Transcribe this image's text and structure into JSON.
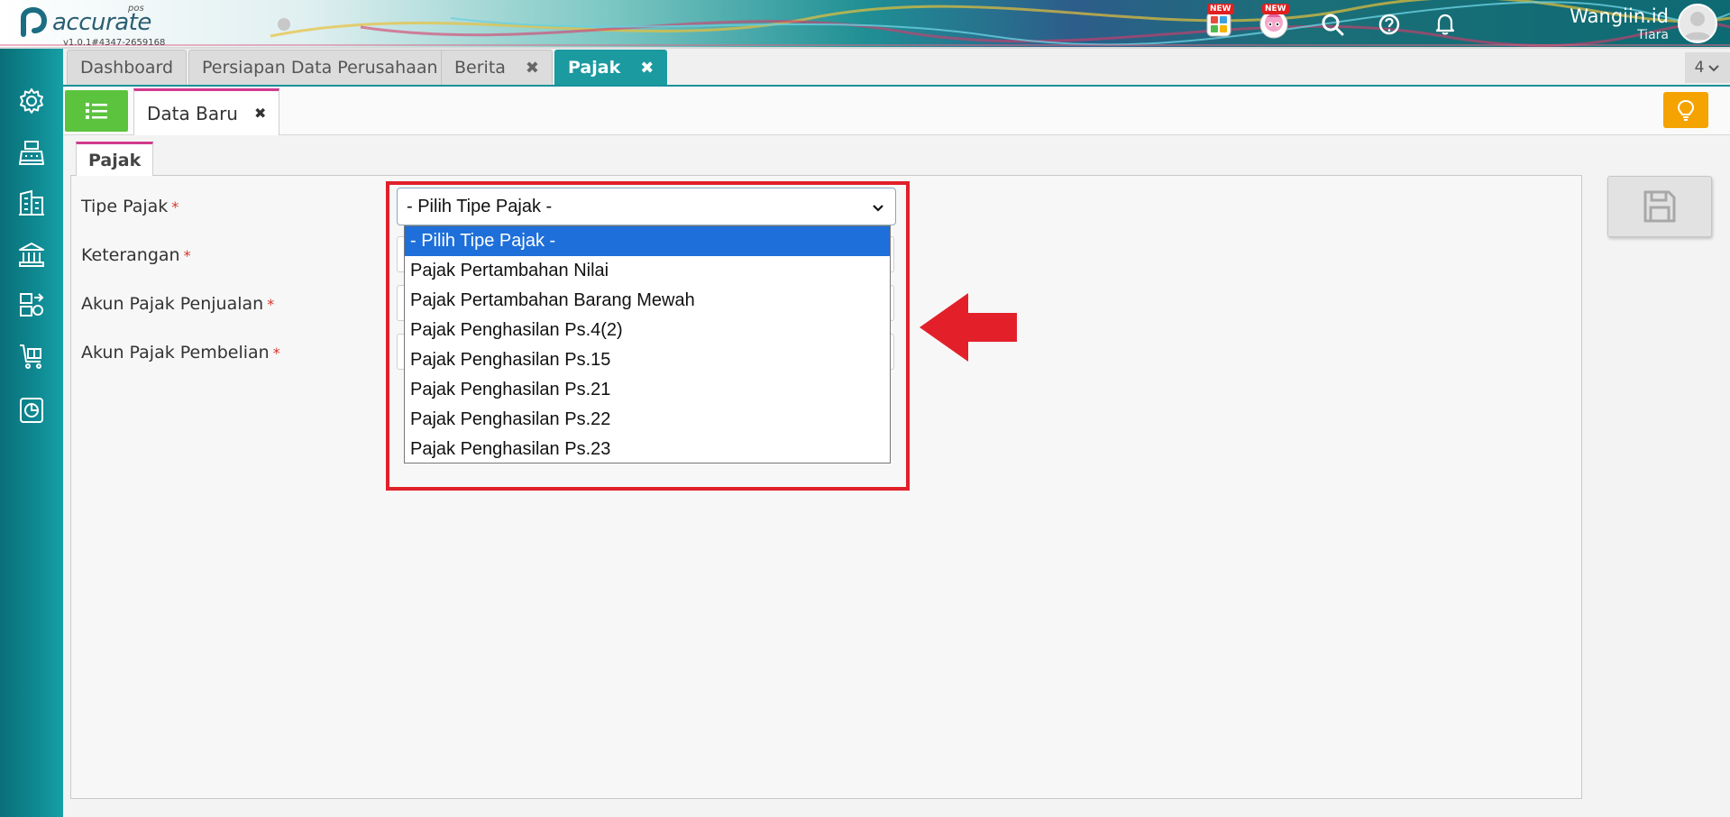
{
  "app": {
    "logo_text": "accurate",
    "logo_sub": "pos",
    "version": "v1.0.1#4347-2659168"
  },
  "header": {
    "badge_new": "NEW",
    "user_name": "Wangiin.id",
    "user_sub": "Tiara"
  },
  "tabs": [
    {
      "label": "Dashboard"
    },
    {
      "label": "Persiapan Data Perusahaan"
    },
    {
      "label": "Berita",
      "close": "✖"
    },
    {
      "label": "Pajak",
      "close": "✖"
    }
  ],
  "tab_count": "4",
  "subtab": {
    "label": "Data Baru",
    "close": "✖"
  },
  "form": {
    "tab_label": "Pajak",
    "required_mark": "*",
    "fields": [
      {
        "label": "Tipe Pajak"
      },
      {
        "label": "Keterangan"
      },
      {
        "label": "Akun Pajak Penjualan"
      },
      {
        "label": "Akun Pajak Pembelian"
      }
    ],
    "select_value": "- Pilih Tipe Pajak -",
    "options": [
      "- Pilih Tipe Pajak -",
      "Pajak Pertambahan Nilai",
      "Pajak Pertambahan Barang Mewah",
      "Pajak Penghasilan Ps.4(2)",
      "Pajak Penghasilan Ps.15",
      "Pajak Penghasilan Ps.21",
      "Pajak Penghasilan Ps.22",
      "Pajak Penghasilan Ps.23"
    ]
  },
  "colors": {
    "brand_teal": "#1b9aa0",
    "highlight_red": "#e0202a",
    "selected_blue": "#1e6fd9",
    "list_green": "#5cc33e",
    "bulb_orange": "#f5a300"
  },
  "icons": {
    "sidebar": [
      "gear-icon",
      "cash-register-icon",
      "building-icon",
      "bank-icon",
      "inventory-icon",
      "cart-icon",
      "report-icon"
    ],
    "header": [
      "app-grid-icon",
      "mascot-icon",
      "search-icon",
      "help-icon",
      "bell-icon"
    ]
  }
}
